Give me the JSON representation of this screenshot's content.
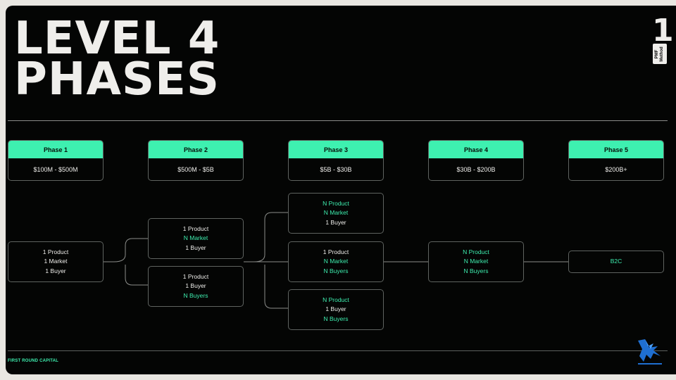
{
  "title": {
    "line1": "LEVEL 4",
    "line2": "PHASES"
  },
  "badge": {
    "number": "1",
    "label_line1": "PMF",
    "label_line2": "Method"
  },
  "footer": {
    "brand": "FIRST ROUND CAPITAL"
  },
  "phases": [
    {
      "label": "Phase 1",
      "range": "$100M - $500M"
    },
    {
      "label": "Phase 2",
      "range": "$500M - $5B"
    },
    {
      "label": "Phase 3",
      "range": "$5B - $30B"
    },
    {
      "label": "Phase 4",
      "range": "$30B - $200B"
    },
    {
      "label": "Phase 5",
      "range": "$200B+"
    }
  ],
  "nodes": {
    "p1": [
      {
        "text": "1 Product",
        "highlight": false
      },
      {
        "text": "1 Market",
        "highlight": false
      },
      {
        "text": "1 Buyer",
        "highlight": false
      }
    ],
    "p2a": [
      {
        "text": "1 Product",
        "highlight": false
      },
      {
        "text": "N Market",
        "highlight": true
      },
      {
        "text": "1 Buyer",
        "highlight": false
      }
    ],
    "p2b": [
      {
        "text": "1 Product",
        "highlight": false
      },
      {
        "text": "1 Buyer",
        "highlight": false
      },
      {
        "text": "N Buyers",
        "highlight": true
      }
    ],
    "p3a": [
      {
        "text": "N Product",
        "highlight": true
      },
      {
        "text": "N Market",
        "highlight": true
      },
      {
        "text": "1 Buyer",
        "highlight": false
      }
    ],
    "p3b": [
      {
        "text": "1 Product",
        "highlight": false
      },
      {
        "text": "N Market",
        "highlight": true
      },
      {
        "text": "N Buyers",
        "highlight": true
      }
    ],
    "p3c": [
      {
        "text": "N Product",
        "highlight": true
      },
      {
        "text": "1 Buyer",
        "highlight": false
      },
      {
        "text": "N Buyers",
        "highlight": true
      }
    ],
    "p4": [
      {
        "text": "N Product",
        "highlight": true
      },
      {
        "text": "N Market",
        "highlight": true
      },
      {
        "text": "N Buyers",
        "highlight": true
      }
    ],
    "p5": [
      {
        "text": "B2C",
        "highlight": true
      }
    ]
  },
  "colors": {
    "accent": "#3ef0b0",
    "background": "#040504",
    "text": "#efeeeb",
    "border": "#5f6360"
  },
  "icons": {
    "watermark": "eagle-logo-icon"
  }
}
